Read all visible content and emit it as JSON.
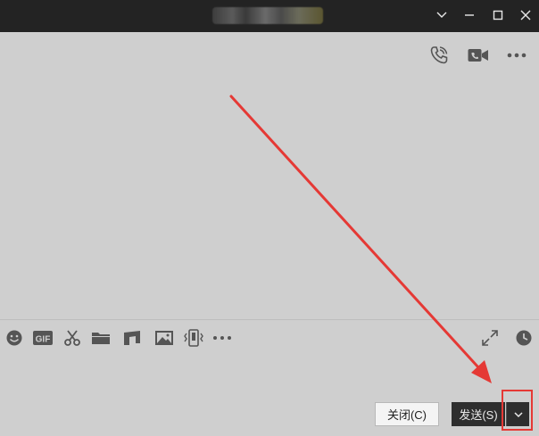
{
  "window": {
    "title": "",
    "controls": [
      "chevron-down-icon",
      "minimize-icon",
      "maximize-icon",
      "close-icon"
    ]
  },
  "header_icons": [
    "phone-call-icon",
    "video-call-icon",
    "more-icon"
  ],
  "toolbar": {
    "left_tools": [
      "emoji-icon",
      "gif-icon",
      "scissors-icon",
      "folder-icon",
      "music-icon",
      "image-icon",
      "shake-icon",
      "more-icon"
    ],
    "gif_label": "GIF",
    "right_tools": [
      "expand-icon",
      "history-icon"
    ]
  },
  "input": {
    "value": ""
  },
  "buttons": {
    "close_label": "关闭(C)",
    "send_label": "发送(S)"
  },
  "annotation": {
    "color": "#e53935",
    "kind": "arrow pointing to send options dropdown"
  },
  "colors": {
    "titlebar": "#232323",
    "background": "#cfcfcf",
    "icon": "#555555",
    "send_button": "#2e2e2e"
  }
}
